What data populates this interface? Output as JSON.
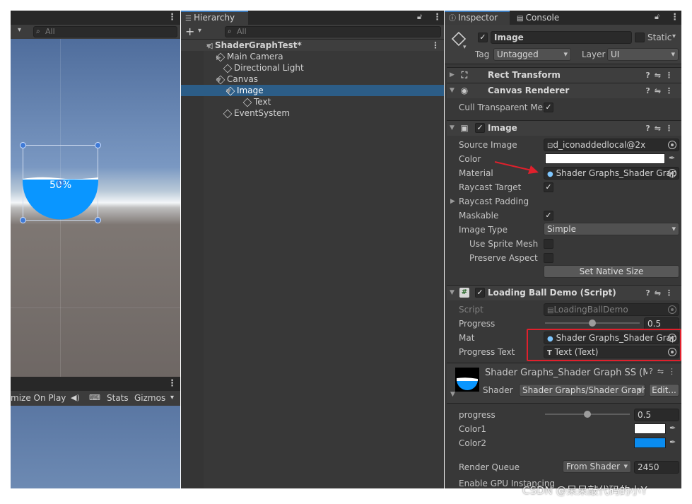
{
  "scene_toolbar": {
    "search_placeholder": "All"
  },
  "scene_view": {
    "progress_label": "50%"
  },
  "game_toolbar": {
    "maximize": "mize On Play",
    "stats": "Stats",
    "gizmos": "Gizmos"
  },
  "hierarchy": {
    "tab": "Hierarchy",
    "search_placeholder": "All",
    "root": "ShaderGraphTest*",
    "items": [
      "Main Camera",
      "Directional Light",
      "Canvas",
      "Image",
      "Text",
      "EventSystem"
    ]
  },
  "inspector": {
    "tabs": [
      "Inspector",
      "Console"
    ],
    "object_name": "Image",
    "static_label": "Static",
    "tag_label": "Tag",
    "tag_value": "Untagged",
    "layer_label": "Layer",
    "layer_value": "UI",
    "rect_transform": "Rect Transform",
    "canvas_renderer": "Canvas Renderer",
    "cull_label": "Cull Transparent Mes",
    "image_component": "Image",
    "image_fields": {
      "source_image_label": "Source Image",
      "source_image_value": "d_iconaddedlocal@2x",
      "color_label": "Color",
      "material_label": "Material",
      "material_value": "Shader Graphs_Shader Grap",
      "raycast_target_label": "Raycast Target",
      "raycast_padding_label": "Raycast Padding",
      "maskable_label": "Maskable",
      "image_type_label": "Image Type",
      "image_type_value": "Simple",
      "use_sprite_mesh_label": "Use Sprite Mesh",
      "preserve_aspect_label": "Preserve Aspect",
      "set_native_size": "Set Native Size"
    },
    "script_component": "Loading Ball Demo (Script)",
    "script_fields": {
      "script_label": "Script",
      "script_value": "LoadingBallDemo",
      "progress_label": "Progress",
      "progress_value": "0.5",
      "mat_label": "Mat",
      "mat_value": "Shader Graphs_Shader Grap",
      "progress_text_label": "Progress Text",
      "progress_text_value": "Text (Text)"
    },
    "material": {
      "title": "Shader Graphs_Shader Graph SS (M",
      "shader_label": "Shader",
      "shader_value": "Shader Graphs/Shader Graph",
      "edit_button": "Edit...",
      "progress_label": "progress",
      "progress_value": "0.5",
      "color1_label": "Color1",
      "color2_label": "Color2",
      "render_queue_label": "Render Queue",
      "render_queue_mode": "From Shader",
      "render_queue_value": "2450",
      "gpu_instancing_label": "Enable GPU Instancing"
    }
  },
  "colors": {
    "accent": "#3a79bb",
    "water": "#0a96ff",
    "color1": "#ffffff",
    "color2": "#0a8cf0",
    "highlight_red": "#e0202c"
  },
  "progress_fraction": 0.5,
  "watermark": "CSDN @呆呆敲代码的小Y"
}
